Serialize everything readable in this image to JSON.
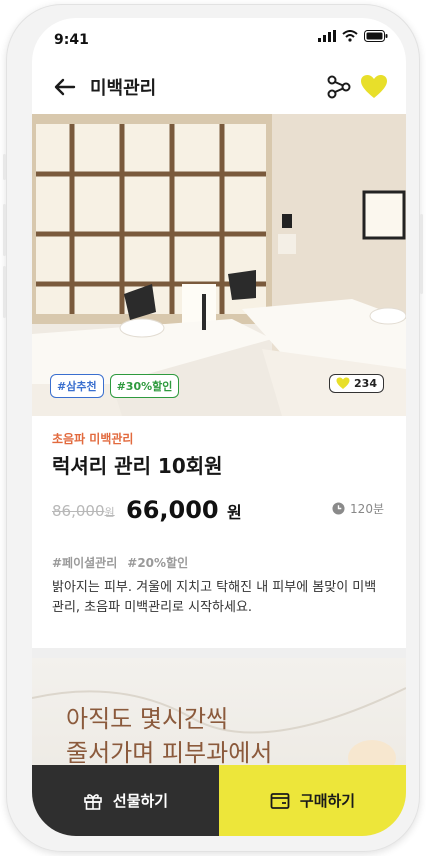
{
  "status": {
    "time": "9:41"
  },
  "header": {
    "title": "미백관리"
  },
  "badges": {
    "tag1": "#삼추천",
    "tag2": "#30%할인",
    "likes": "234"
  },
  "product": {
    "category": "초음파 미백관리",
    "name": "럭셔리 관리 10회원",
    "original_price": "86,000",
    "original_unit": "원",
    "price": "66,000",
    "price_unit": "원",
    "duration": "120분",
    "hashtags": [
      "#페이셜관리",
      "#20%할인"
    ],
    "description": "밝아지는 피부. 겨울에 지치고 탁해진 내 피부에 봄맞이 미백 관리, 초음파 미백관리로 시작하세요."
  },
  "promo": {
    "line1": "아직도 몇시간씩",
    "line2": "줄서가며 피부과에서"
  },
  "bottom": {
    "gift_label": "선물하기",
    "buy_label": "구매하기"
  },
  "colors": {
    "accent_yellow": "#ede63a",
    "dark": "#2f2f2f",
    "category_orange": "#e26a3e",
    "tag_blue": "#3a6fcf",
    "tag_green": "#2e9a3e"
  },
  "icons": {
    "back": "arrow-left-icon",
    "share": "share-icon",
    "favorite": "heart-icon",
    "clock": "clock-icon",
    "gift": "gift-icon",
    "wallet": "wallet-icon"
  }
}
